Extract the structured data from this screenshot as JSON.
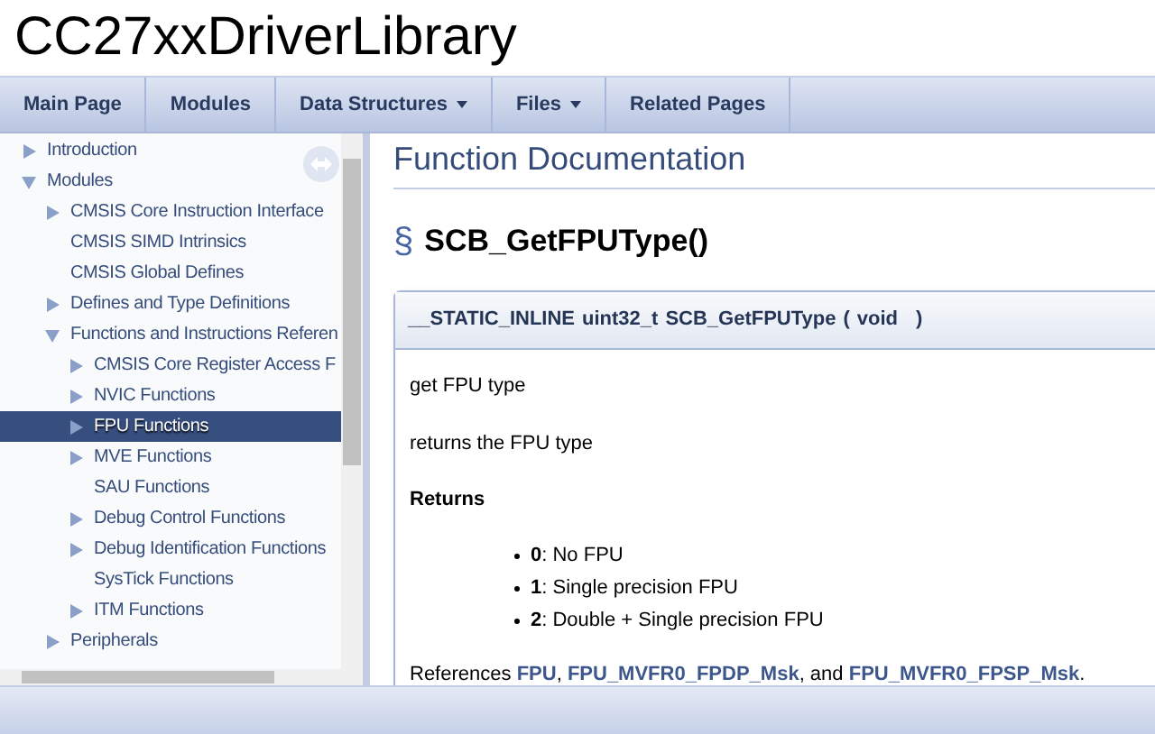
{
  "project_title": "CC27xxDriverLibrary",
  "nav": [
    {
      "label": "Main Page",
      "dropdown": false
    },
    {
      "label": "Modules",
      "dropdown": false
    },
    {
      "label": "Data Structures",
      "dropdown": true
    },
    {
      "label": "Files",
      "dropdown": true
    },
    {
      "label": "Related Pages",
      "dropdown": false
    }
  ],
  "sidebar": {
    "items": [
      {
        "label": "Introduction",
        "kind": "branch",
        "expanded": false,
        "selected": false
      },
      {
        "label": "Modules",
        "kind": "branch",
        "expanded": true,
        "selected": false,
        "children": [
          {
            "label": "CMSIS Core Instruction Interface",
            "kind": "branch",
            "expanded": false,
            "selected": false
          },
          {
            "label": "CMSIS SIMD Intrinsics",
            "kind": "leaf",
            "selected": false
          },
          {
            "label": "CMSIS Global Defines",
            "kind": "leaf",
            "selected": false
          },
          {
            "label": "Defines and Type Definitions",
            "kind": "branch",
            "expanded": false,
            "selected": false
          },
          {
            "label": "Functions and Instructions Referen",
            "kind": "branch",
            "expanded": true,
            "selected": false,
            "children": [
              {
                "label": "CMSIS Core Register Access F",
                "kind": "branch",
                "expanded": false,
                "selected": false
              },
              {
                "label": "NVIC Functions",
                "kind": "branch",
                "expanded": false,
                "selected": false
              },
              {
                "label": "FPU Functions",
                "kind": "branch",
                "expanded": false,
                "selected": true
              },
              {
                "label": "MVE Functions",
                "kind": "branch",
                "expanded": false,
                "selected": false
              },
              {
                "label": "SAU Functions",
                "kind": "leaf",
                "selected": false
              },
              {
                "label": "Debug Control Functions",
                "kind": "branch",
                "expanded": false,
                "selected": false
              },
              {
                "label": "Debug Identification Functions",
                "kind": "branch",
                "expanded": false,
                "selected": false
              },
              {
                "label": "SysTick Functions",
                "kind": "leaf",
                "selected": false
              },
              {
                "label": "ITM Functions",
                "kind": "branch",
                "expanded": false,
                "selected": false
              }
            ]
          },
          {
            "label": "Peripherals",
            "kind": "branch",
            "expanded": false,
            "selected": false
          }
        ]
      }
    ]
  },
  "content": {
    "section_title": "Function Documentation",
    "anchor": "§",
    "function_name": "SCB_GetFPUType()",
    "signature": {
      "qualifier": "__STATIC_INLINE",
      "return_type": "uint32_t",
      "name": "SCB_GetFPUType",
      "open": "(",
      "param": "void",
      "close": ")"
    },
    "brief": "get FPU type",
    "details": "returns the FPU type",
    "returns_heading": "Returns",
    "returns": [
      "**0**: No FPU",
      "**1**: Single precision FPU",
      "**2**: Double + Single precision FPU"
    ],
    "references": [
      {
        "kind": "text",
        "text": "References "
      },
      {
        "kind": "link",
        "text": "FPU"
      },
      {
        "kind": "text",
        "text": ", "
      },
      {
        "kind": "link",
        "text": "FPU_MVFR0_FPDP_Msk"
      },
      {
        "kind": "text",
        "text": ", and "
      },
      {
        "kind": "link",
        "text": "FPU_MVFR0_FPSP_Msk"
      },
      {
        "kind": "text",
        "text": "."
      }
    ]
  }
}
